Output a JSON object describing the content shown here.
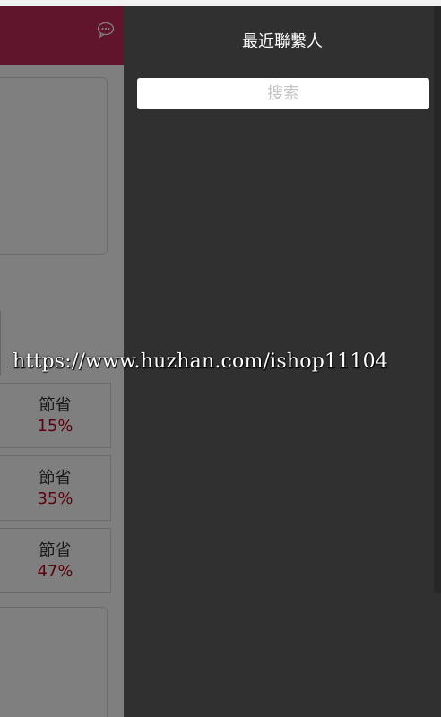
{
  "drawer": {
    "title": "最近聯繫人",
    "search_placeholder": "搜索"
  },
  "app": {
    "header_color": "#c32a5a",
    "icons": {
      "header_right": "chat-bubble-icon"
    },
    "save_cards": [
      {
        "label": "節省",
        "percent": "15%"
      },
      {
        "label": "節省",
        "percent": "35%"
      },
      {
        "label": "節省",
        "percent": "47%"
      }
    ]
  },
  "watermark": "https://www.huzhan.com/ishop11104"
}
